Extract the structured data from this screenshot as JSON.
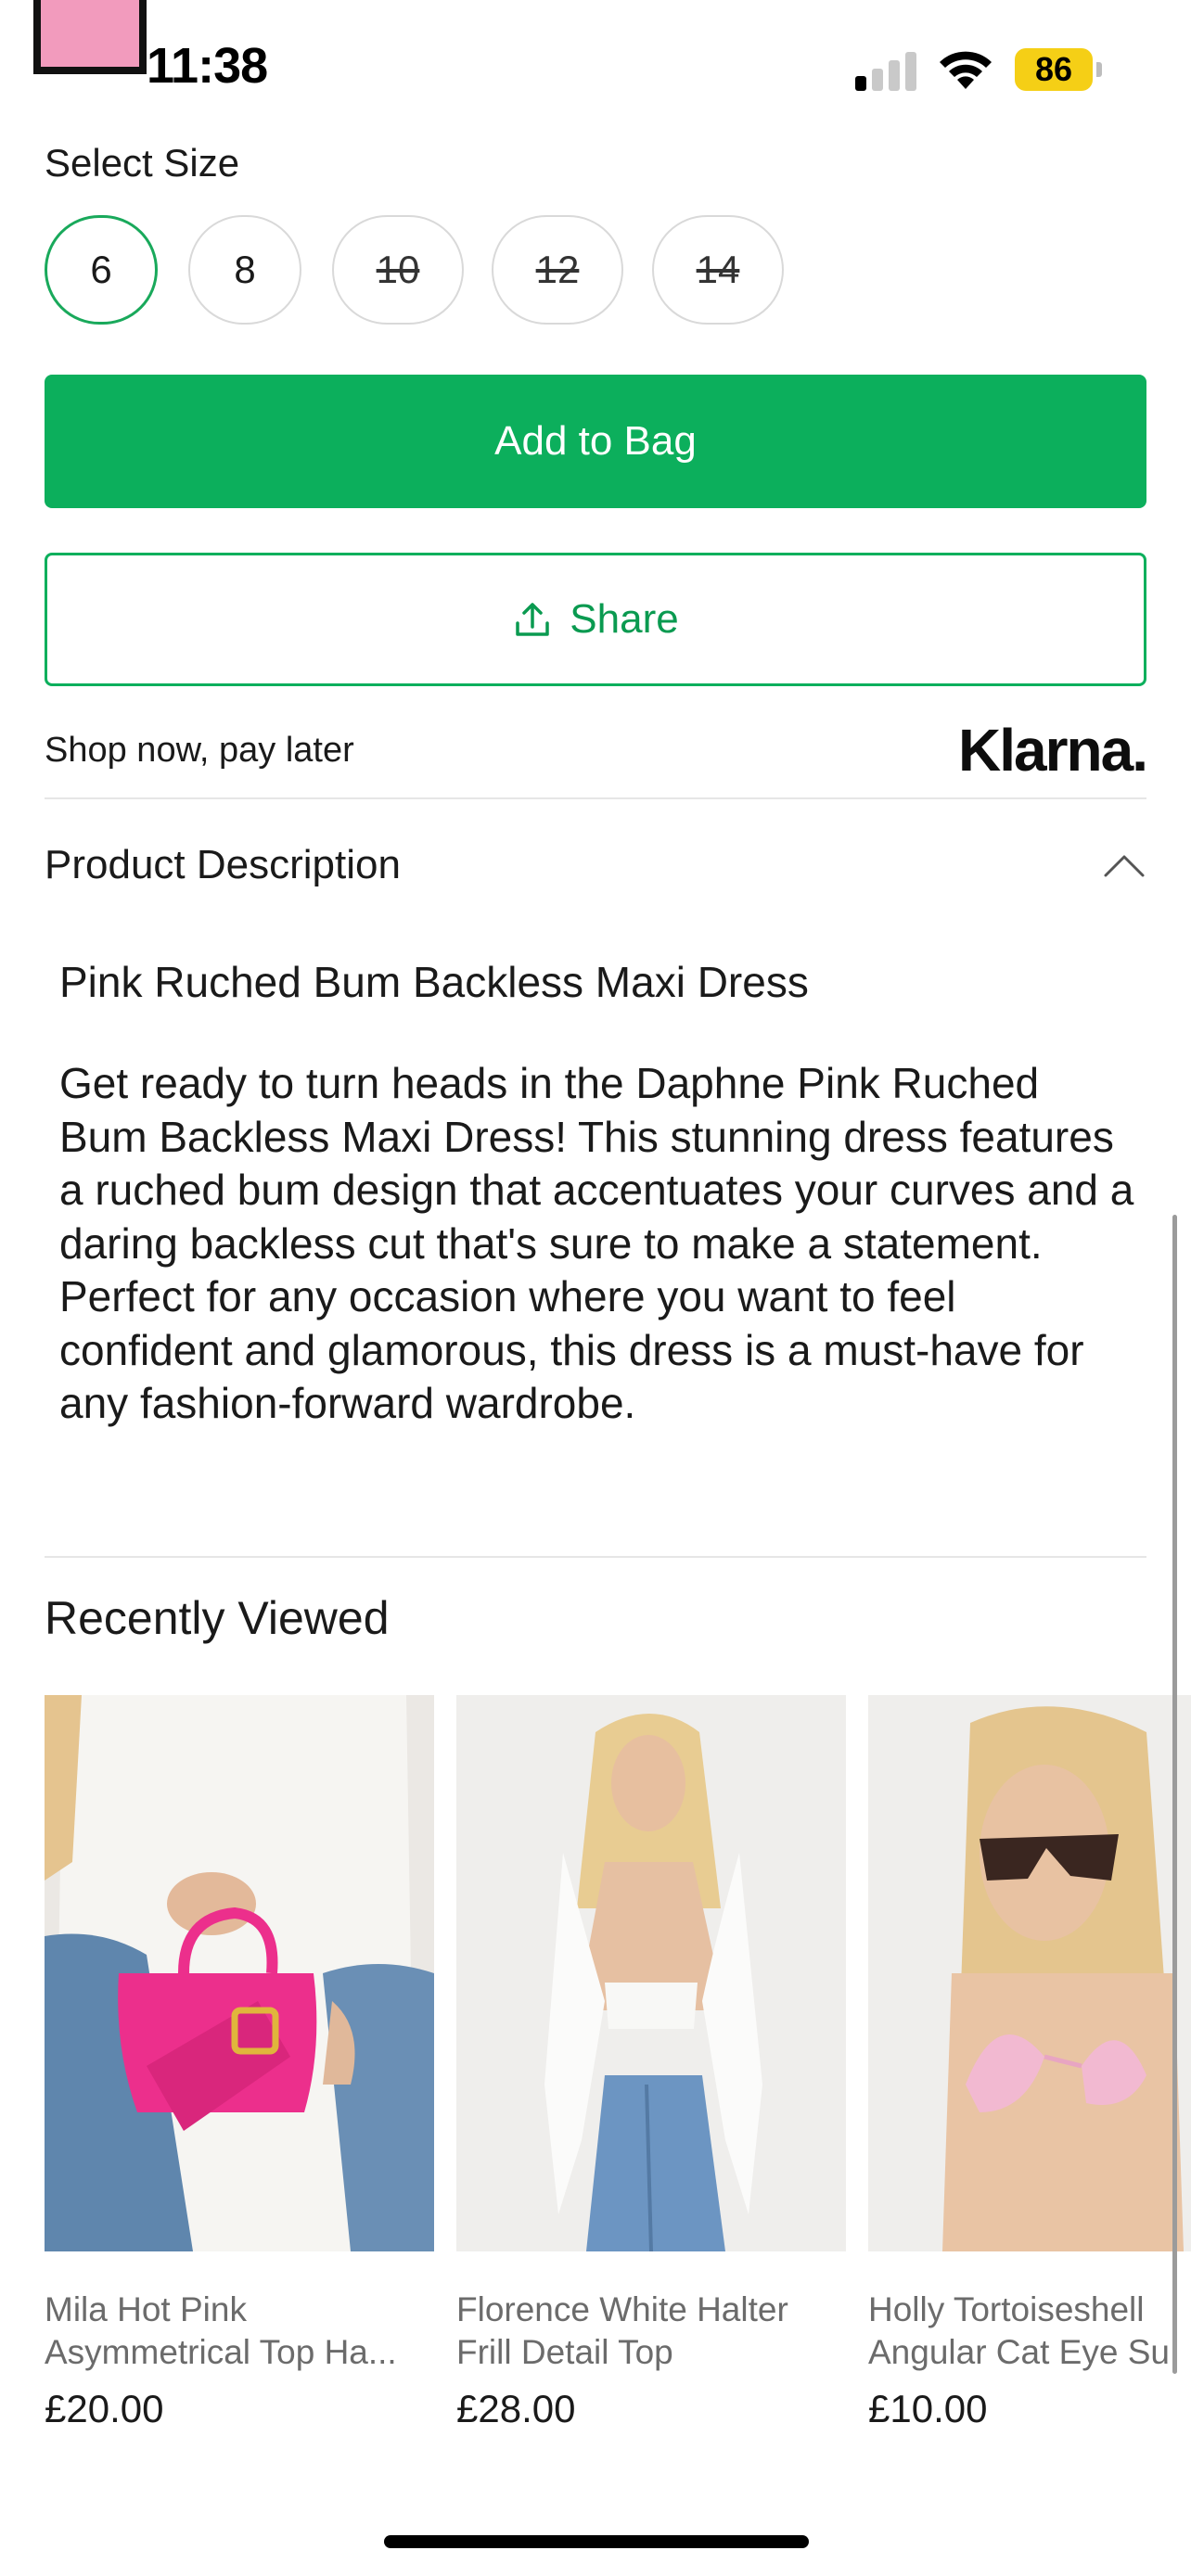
{
  "status_bar": {
    "time": "11:38",
    "battery": "86",
    "battery_color": "#f5cf16"
  },
  "size_selector": {
    "label": "Select Size",
    "sizes": [
      {
        "label": "6",
        "available": true,
        "selected": true
      },
      {
        "label": "8",
        "available": true,
        "selected": false
      },
      {
        "label": "10",
        "available": false,
        "selected": false
      },
      {
        "label": "12",
        "available": false,
        "selected": false
      },
      {
        "label": "14",
        "available": false,
        "selected": false
      }
    ]
  },
  "actions": {
    "add_to_bag": "Add to Bag",
    "share": "Share",
    "accent_color": "#0caf5c"
  },
  "klarna": {
    "text": "Shop now, pay later",
    "logo": "Klarna."
  },
  "product_description": {
    "header": "Product Description",
    "name": "Pink Ruched Bum Backless Maxi Dress",
    "body": "Get ready to turn heads in the Daphne Pink Ruched Bum Backless Maxi Dress! This stunning dress features a ruched bum design that accentuates your curves and a daring backless cut that's sure to make a statement. Perfect for any occasion where you want to feel confident and glamorous, this dress is a must-have for any fashion-forward wardrobe."
  },
  "recently_viewed": {
    "title": "Recently Viewed",
    "items": [
      {
        "line1": "Mila Hot Pink",
        "line2": "Asymmetrical Top Ha...",
        "price": "£20.00",
        "image": "pink-handbag-photo"
      },
      {
        "line1": "Florence White Halter",
        "line2": "Frill Detail Top",
        "price": "£28.00",
        "image": "white-halter-top-photo"
      },
      {
        "line1": "Holly Tortoiseshell",
        "line2": "Angular Cat Eye Su",
        "price": "£10.00",
        "image": "sunglasses-bikini-photo"
      }
    ]
  }
}
